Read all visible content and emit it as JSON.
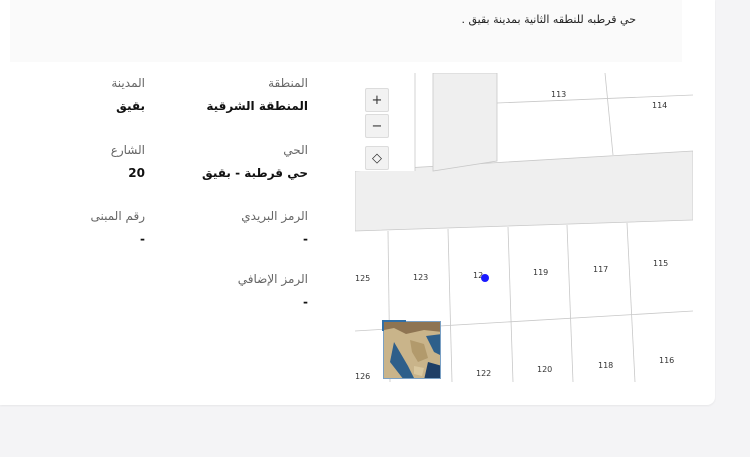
{
  "description": "حي قرطبه للنطقه الثانية بمدينة بقيق .",
  "fields": {
    "region": {
      "label": "المنطقة",
      "value": "المنطقة الشرقية"
    },
    "city": {
      "label": "المدينة",
      "value": "بقيق"
    },
    "district": {
      "label": "الحي",
      "value": "حي قرطبة - بقيق"
    },
    "street": {
      "label": "الشارع",
      "value": "20"
    },
    "postal_code": {
      "label": "الرمز البريدي",
      "value": "-"
    },
    "building_no": {
      "label": "رقم المبنى",
      "value": "-"
    },
    "additional_code": {
      "label": "الرمز الإضافي",
      "value": "-"
    }
  },
  "map": {
    "zoom_in": "+",
    "zoom_out": "−",
    "locate": "◇",
    "parcels": [
      "113",
      "114",
      "125",
      "123",
      "12",
      "119",
      "117",
      "115",
      "126",
      "122",
      "120",
      "118",
      "116"
    ],
    "marker_color": "#1a1aff"
  }
}
